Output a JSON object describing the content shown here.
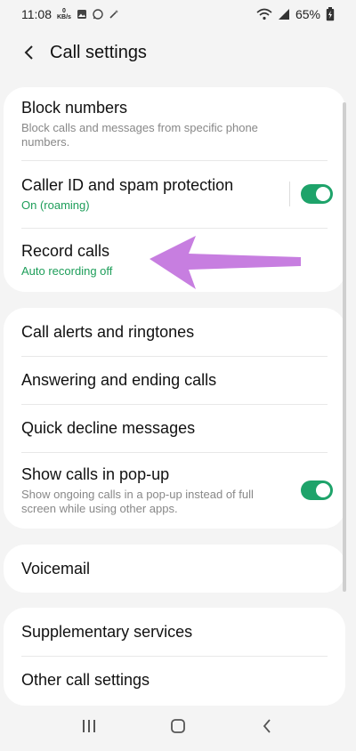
{
  "status_bar": {
    "time": "11:08",
    "kbs_value": "0",
    "kbs_unit": "KB/s",
    "battery": "65%"
  },
  "header": {
    "title": "Call settings"
  },
  "groups": [
    {
      "items": [
        {
          "title": "Block numbers",
          "subtitle": "Block calls and messages from specific phone numbers."
        },
        {
          "title": "Caller ID and spam protection",
          "subtitle": "On (roaming)",
          "toggle": true
        },
        {
          "title": "Record calls",
          "subtitle": "Auto recording off"
        }
      ]
    },
    {
      "items": [
        {
          "title": "Call alerts and ringtones"
        },
        {
          "title": "Answering and ending calls"
        },
        {
          "title": "Quick decline messages"
        },
        {
          "title": "Show calls in pop-up",
          "subtitle": "Show ongoing calls in a pop-up instead of full screen while using other apps.",
          "toggle": true
        }
      ]
    },
    {
      "items": [
        {
          "title": "Voicemail"
        }
      ]
    },
    {
      "items": [
        {
          "title": "Supplementary services"
        },
        {
          "title": "Other call settings"
        }
      ]
    }
  ],
  "colors": {
    "accent_green": "#1ea36a",
    "annotation_arrow": "#c77ee0"
  },
  "icons": {
    "back": "chevron-left-icon",
    "recents": "recents-icon",
    "home": "home-icon",
    "nav_back": "back-icon"
  }
}
